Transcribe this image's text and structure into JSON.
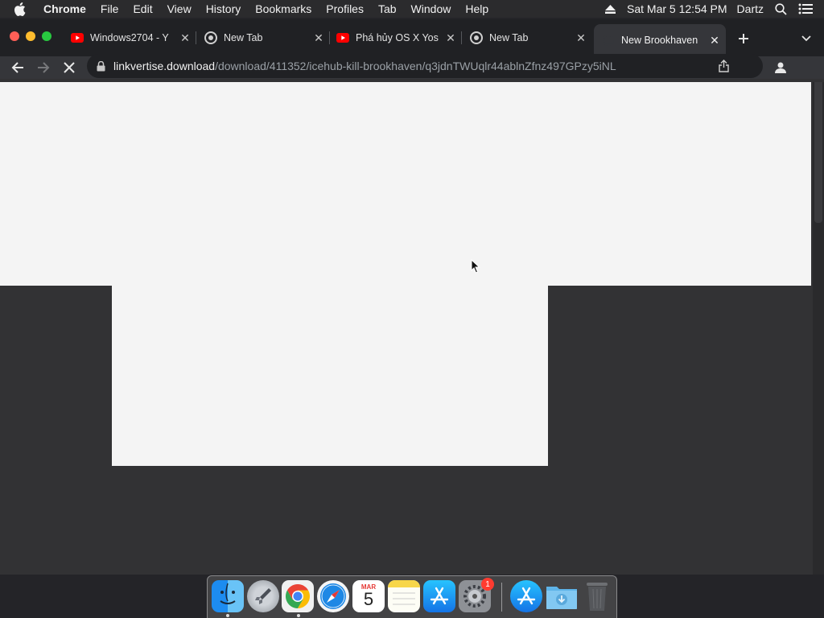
{
  "menubar": {
    "app_name": "Chrome",
    "menus": [
      "File",
      "Edit",
      "View",
      "History",
      "Bookmarks",
      "Profiles",
      "Tab",
      "Window",
      "Help"
    ],
    "clock": "Sat Mar 5  12:54 PM",
    "user": "Dartz",
    "icons": [
      "apple-icon",
      "eject-icon",
      "spotlight-search-icon",
      "control-center-icon"
    ]
  },
  "browser": {
    "tabs": [
      {
        "title": "Windows2704 - Y",
        "favicon": "youtube-icon",
        "active": false
      },
      {
        "title": "New Tab",
        "favicon": "chrome-icon",
        "active": false
      },
      {
        "title": "Phá hủy OS X Yos",
        "favicon": "youtube-icon",
        "active": false
      },
      {
        "title": "New Tab",
        "favicon": "chrome-icon",
        "active": false
      },
      {
        "title": "New Brookhaven",
        "favicon": "",
        "active": true
      }
    ],
    "address": {
      "host": "linkvertise.download",
      "path": "/download/411352/icehub-kill-brookhaven/q3jdnTWUqlr44ablnZfnz497GPzy5iNL"
    },
    "loading": true
  },
  "dock": {
    "apps": [
      "Finder",
      "Launchpad",
      "Google Chrome",
      "Safari",
      "Calendar",
      "Notes",
      "App Store",
      "System Preferences",
      "App Store",
      "Downloads",
      "Trash"
    ],
    "calendar": {
      "month": "MAR",
      "day": "5"
    },
    "system_preferences_badge": "1"
  },
  "colors": {
    "menubar_bg": "#2b2b2d",
    "tabstrip_bg": "#202124",
    "toolbar_bg": "#35363a",
    "page_bg": "#f4f4f4",
    "youtube_red": "#ff0000"
  }
}
